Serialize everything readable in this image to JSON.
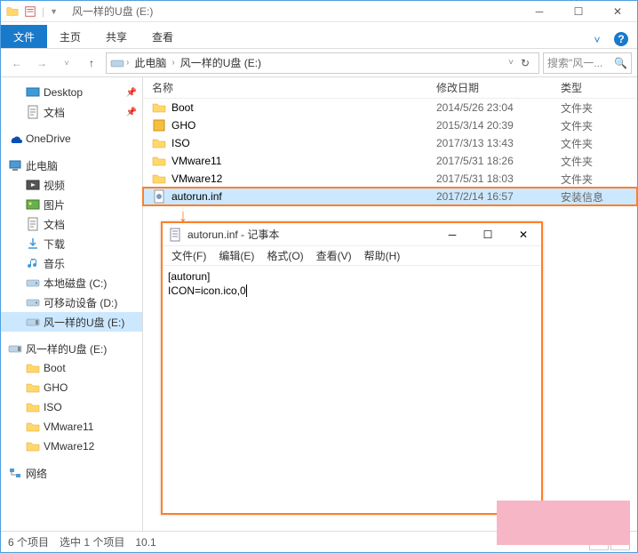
{
  "window": {
    "title": "风一样的U盘 (E:)"
  },
  "ribbon": {
    "file": "文件",
    "tabs": [
      "主页",
      "共享",
      "查看"
    ]
  },
  "breadcrumb": {
    "root": "此电脑",
    "current": "风一样的U盘 (E:)"
  },
  "search": {
    "placeholder": "搜索\"风一..."
  },
  "columns": {
    "name": "名称",
    "date": "修改日期",
    "type": "类型"
  },
  "sidebar": {
    "quick": [
      {
        "label": "Desktop",
        "icon": "desktop",
        "pinned": true
      },
      {
        "label": "文档",
        "icon": "doc",
        "pinned": true
      }
    ],
    "onedrive": "OneDrive",
    "thispc": "此电脑",
    "thispc_items": [
      {
        "label": "视频",
        "icon": "video"
      },
      {
        "label": "图片",
        "icon": "pic"
      },
      {
        "label": "文档",
        "icon": "doc"
      },
      {
        "label": "下载",
        "icon": "dl"
      },
      {
        "label": "音乐",
        "icon": "music"
      },
      {
        "label": "本地磁盘 (C:)",
        "icon": "drive"
      },
      {
        "label": "可移动设备 (D:)",
        "icon": "drive"
      },
      {
        "label": "风一样的U盘 (E:)",
        "icon": "usb",
        "selected": true
      }
    ],
    "usb_root": "风一样的U盘 (E:)",
    "usb_items": [
      "Boot",
      "GHO",
      "ISO",
      "VMware11",
      "VMware12"
    ],
    "network": "网络"
  },
  "files": [
    {
      "name": "Boot",
      "date": "2014/5/26 23:04",
      "type": "文件夹",
      "icon": "folder"
    },
    {
      "name": "GHO",
      "date": "2015/3/14 20:39",
      "type": "文件夹",
      "icon": "gho"
    },
    {
      "name": "ISO",
      "date": "2017/3/13 13:43",
      "type": "文件夹",
      "icon": "folder"
    },
    {
      "name": "VMware11",
      "date": "2017/5/31 18:26",
      "type": "文件夹",
      "icon": "folder"
    },
    {
      "name": "VMware12",
      "date": "2017/5/31 18:03",
      "type": "文件夹",
      "icon": "folder"
    },
    {
      "name": "autorun.inf",
      "date": "2017/2/14 16:57",
      "type": "安装信息",
      "icon": "inf",
      "selected": true
    }
  ],
  "notepad": {
    "title": "autorun.inf - 记事本",
    "menus": [
      "文件(F)",
      "编辑(E)",
      "格式(O)",
      "查看(V)",
      "帮助(H)"
    ],
    "content": "[autorun]\nICON=icon.ico,0"
  },
  "status": {
    "count": "6 个项目",
    "selected": "选中 1 个项目",
    "size": "10.1"
  }
}
